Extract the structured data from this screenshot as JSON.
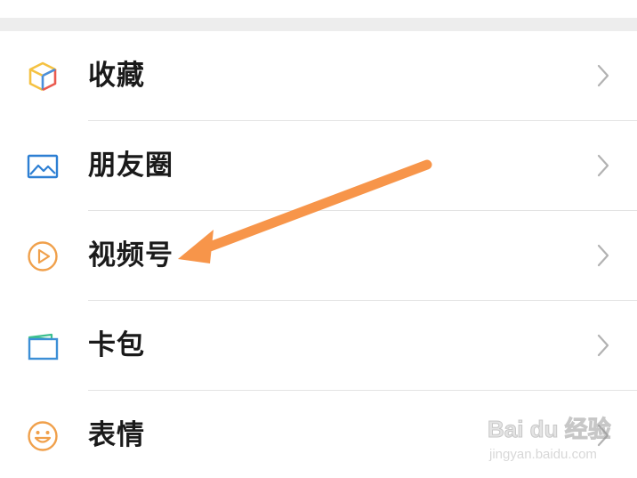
{
  "menu": {
    "items": [
      {
        "label": "收藏",
        "icon": "cube-icon"
      },
      {
        "label": "朋友圈",
        "icon": "image-icon"
      },
      {
        "label": "视频号",
        "icon": "play-circle-icon"
      },
      {
        "label": "卡包",
        "icon": "card-wallet-icon"
      },
      {
        "label": "表情",
        "icon": "smiley-icon"
      }
    ]
  },
  "colors": {
    "background": "#ffffff",
    "separator_gap": "#ededed",
    "divider": "#e3e3e3",
    "label": "#1a1a1a",
    "chevron": "#b2b2b2",
    "arrow": "#f7954a",
    "cube_yellow": "#f5c242",
    "cube_red": "#ea5a4f",
    "cube_blue": "#4a8fdc",
    "image_blue": "#2d7fd3",
    "play_orange": "#f0a04b",
    "card_blue": "#3c8fd6",
    "card_green": "#3cbf8f",
    "smiley_orange": "#f0a04b"
  },
  "watermark": {
    "logo_text": "Bai du 经验",
    "url": "jingyan.baidu.com"
  }
}
